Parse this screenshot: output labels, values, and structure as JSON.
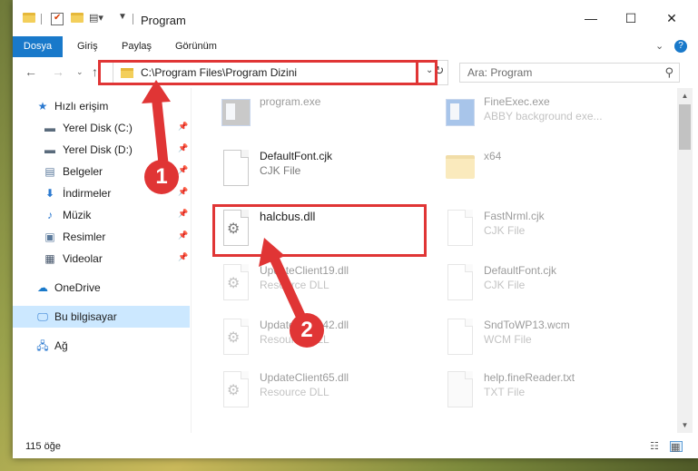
{
  "window": {
    "title": "Program",
    "controls": {
      "minimize": "—",
      "maximize": "☐",
      "close": "✕"
    }
  },
  "ribbon": {
    "tabs": [
      {
        "label": "Dosya",
        "active": true
      },
      {
        "label": "Giriş"
      },
      {
        "label": "Paylaş"
      },
      {
        "label": "Görünüm"
      }
    ]
  },
  "address": {
    "path": "C:\\Program Files\\Program Dizini"
  },
  "search": {
    "placeholder": "Ara: Program"
  },
  "nav": {
    "items": [
      {
        "label": "Hızlı erişim",
        "icon": "star-icon"
      },
      {
        "label": "Yerel Disk (C:)",
        "icon": "drive-icon",
        "pinned": true
      },
      {
        "label": "Yerel Disk (D:)",
        "icon": "drive-icon",
        "pinned": true
      },
      {
        "label": "Belgeler",
        "icon": "documents-icon",
        "pinned": true
      },
      {
        "label": "İndirmeler",
        "icon": "download-icon",
        "pinned": true
      },
      {
        "label": "Müzik",
        "icon": "music-icon",
        "pinned": true
      },
      {
        "label": "Resimler",
        "icon": "pictures-icon",
        "pinned": true
      },
      {
        "label": "Videolar",
        "icon": "video-icon",
        "pinned": true
      },
      {
        "label": "OneDrive",
        "icon": "cloud-icon"
      },
      {
        "label": "Bu bilgisayar",
        "icon": "computer-icon",
        "selected": true
      },
      {
        "label": "Ağ",
        "icon": "network-icon"
      }
    ]
  },
  "files": [
    {
      "name": "program.exe",
      "type": "",
      "icon": "installer-icon"
    },
    {
      "name": "FineExec.exe",
      "type": "ABBY background exe...",
      "icon": "exe-icon"
    },
    {
      "name": "DefaultFont.cjk",
      "type": "CJK File",
      "icon": "file-icon"
    },
    {
      "name": "x64",
      "type": "",
      "icon": "folder-icon"
    },
    {
      "name": "halcbus.dll",
      "type": "",
      "icon": "dll-gear-icon",
      "highlighted": true
    },
    {
      "name": "FastNrml.cjk",
      "type": "CJK File",
      "icon": "file-icon"
    },
    {
      "name": "UpdateClient19.dll",
      "type": "Resource DLL",
      "icon": "dll-gear-icon"
    },
    {
      "name": "DefaultFont.cjk",
      "type": "CJK File",
      "icon": "file-icon"
    },
    {
      "name": "UpdateClient42.dll",
      "type": "Resource DLL",
      "icon": "dll-gear-icon"
    },
    {
      "name": "SndToWP13.wcm",
      "type": "WCM File",
      "icon": "file-icon"
    },
    {
      "name": "UpdateClient65.dll",
      "type": "Resource DLL",
      "icon": "dll-gear-icon"
    },
    {
      "name": "help.fineReader.txt",
      "type": "TXT File",
      "icon": "text-file-icon"
    }
  ],
  "status": {
    "count": "115 öğe"
  },
  "annotations": {
    "marker1": "1",
    "marker2": "2",
    "color": "#e03535"
  }
}
